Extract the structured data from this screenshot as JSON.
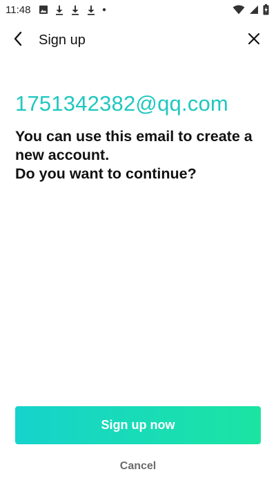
{
  "status_bar": {
    "time": "11:48",
    "left_icons": [
      "image-icon",
      "download-icon",
      "download-icon",
      "download-icon",
      "dot-icon"
    ],
    "right_icons": [
      "wifi-icon",
      "signal-icon",
      "battery-charging-icon"
    ]
  },
  "header": {
    "title": "Sign up",
    "back_icon": "chevron-left-icon",
    "close_icon": "close-icon"
  },
  "content": {
    "email": "1751342382@qq.com",
    "message_line1": "You can use this email to create a",
    "message_line2": "new account.",
    "message_line3": "Do you want to continue?"
  },
  "actions": {
    "primary_label": "Sign up now",
    "cancel_label": "Cancel"
  },
  "colors": {
    "accent": "#1fc7c0",
    "button_gradient_start": "#16d3cc",
    "button_gradient_end": "#1be4a2",
    "cancel_text": "#6b6b6b"
  }
}
